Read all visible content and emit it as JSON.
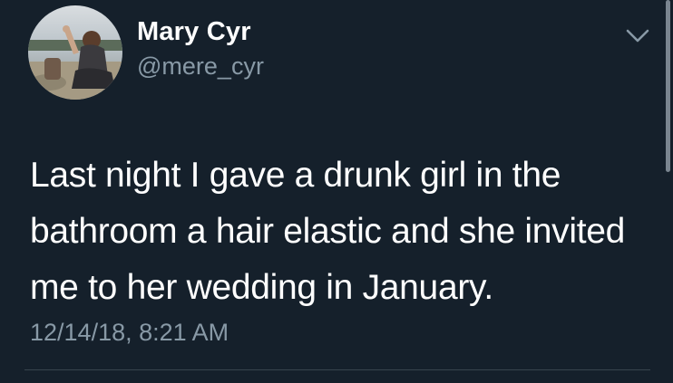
{
  "tweet": {
    "display_name": "Mary Cyr",
    "handle": "@mere_cyr",
    "text_lines": [
      "Last night I gave a drunk girl in the",
      "bathroom a hair elastic and she invited",
      "me to her wedding in January."
    ],
    "timestamp": "12/14/18, 8:21 AM",
    "menu_icon": "chevron-down-icon",
    "avatar_icon": "profile-photo"
  },
  "colors": {
    "background": "#15202b",
    "primary_text": "#ffffff",
    "secondary_text": "#8899a6",
    "divider": "#38444d"
  }
}
